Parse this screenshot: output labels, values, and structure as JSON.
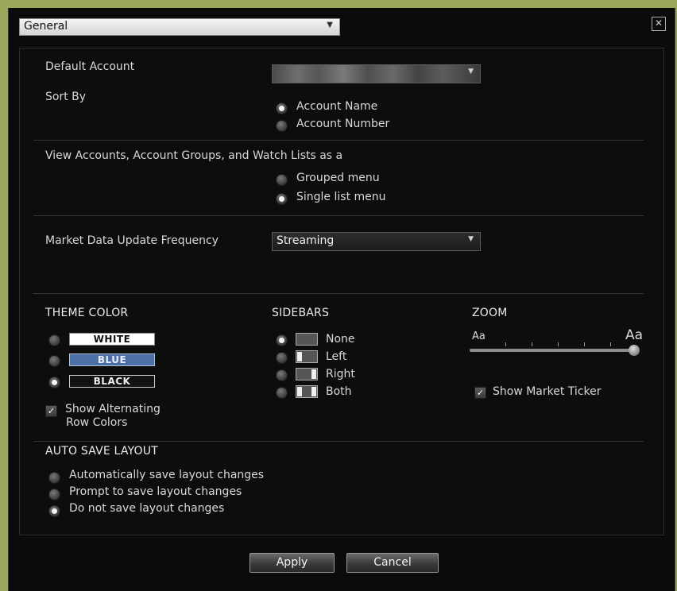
{
  "header": {
    "category_select": "General",
    "close_glyph": "✕"
  },
  "account": {
    "default_label": "Default Account",
    "sort_label": "Sort By",
    "sort_options": [
      "Account Name",
      "Account Number"
    ],
    "sort_selected": 0
  },
  "view_lists": {
    "label": "View Accounts, Account Groups, and Watch Lists as a",
    "options": [
      "Grouped menu",
      "Single list menu"
    ],
    "selected": 1
  },
  "market_data": {
    "label": "Market Data Update Frequency",
    "value": "Streaming"
  },
  "theme": {
    "heading": "THEME COLOR",
    "options": [
      "WHITE",
      "BLUE",
      "BLACK"
    ],
    "selected": 2,
    "alt_rows_line1": "Show Alternating",
    "alt_rows_line2": "Row Colors",
    "alt_rows_checked": true
  },
  "sidebars": {
    "heading": "SIDEBARS",
    "options": [
      "None",
      "Left",
      "Right",
      "Both"
    ],
    "selected": 0
  },
  "zoom": {
    "heading": "ZOOM",
    "min_label": "Aa",
    "max_label": "Aa",
    "level_fraction": 1.0,
    "ticker_label": "Show Market Ticker",
    "ticker_checked": true
  },
  "autosave": {
    "heading": "AUTO SAVE LAYOUT",
    "options": [
      "Automatically save layout changes",
      "Prompt to save layout changes",
      "Do not save layout changes"
    ],
    "selected": 2
  },
  "footer": {
    "apply": "Apply",
    "cancel": "Cancel"
  },
  "colors": {
    "frame": "#9aa65a",
    "panel": "#0b0b0b",
    "blue_swatch": "#4b6fa6"
  }
}
